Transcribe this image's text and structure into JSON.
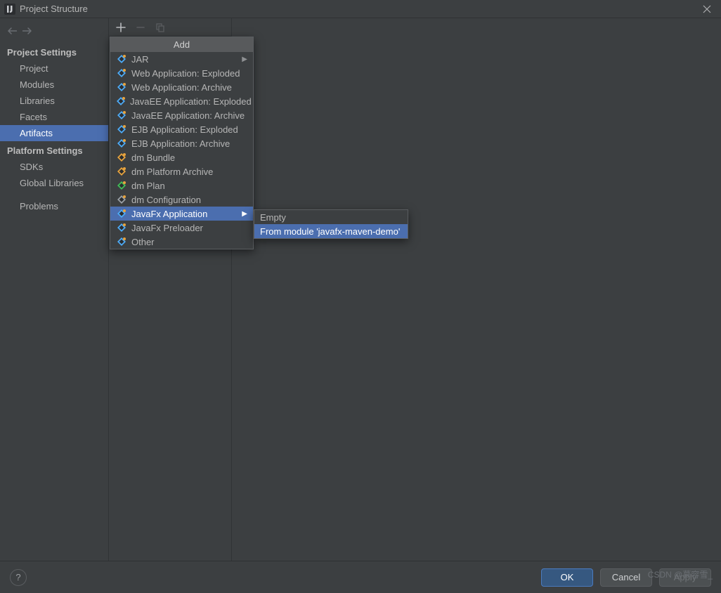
{
  "window": {
    "title": "Project Structure"
  },
  "sidebar": {
    "groups": [
      {
        "header": "Project Settings",
        "items": [
          "Project",
          "Modules",
          "Libraries",
          "Facets",
          "Artifacts"
        ],
        "selected_index": 4
      },
      {
        "header": "Platform Settings",
        "items": [
          "SDKs",
          "Global Libraries"
        ]
      },
      {
        "header": "",
        "items": [
          "Problems"
        ]
      }
    ]
  },
  "add_menu": {
    "title": "Add",
    "items": [
      {
        "label": "JAR",
        "has_submenu": true
      },
      {
        "label": "Web Application: Exploded"
      },
      {
        "label": "Web Application: Archive"
      },
      {
        "label": "JavaEE Application: Exploded"
      },
      {
        "label": "JavaEE Application: Archive"
      },
      {
        "label": "EJB Application: Exploded"
      },
      {
        "label": "EJB Application: Archive"
      },
      {
        "label": "dm Bundle"
      },
      {
        "label": "dm Platform Archive"
      },
      {
        "label": "dm Plan"
      },
      {
        "label": "dm Configuration"
      },
      {
        "label": "JavaFx Application",
        "has_submenu": true,
        "highlighted": true
      },
      {
        "label": "JavaFx Preloader"
      },
      {
        "label": "Other"
      }
    ]
  },
  "submenu": {
    "items": [
      {
        "label": "Empty"
      },
      {
        "label": "From module 'javafx-maven-demo'",
        "highlighted": true
      }
    ]
  },
  "buttons": {
    "ok": "OK",
    "cancel": "Cancel",
    "apply": "Apply"
  },
  "watermark": "CSDN @慕容雪_"
}
